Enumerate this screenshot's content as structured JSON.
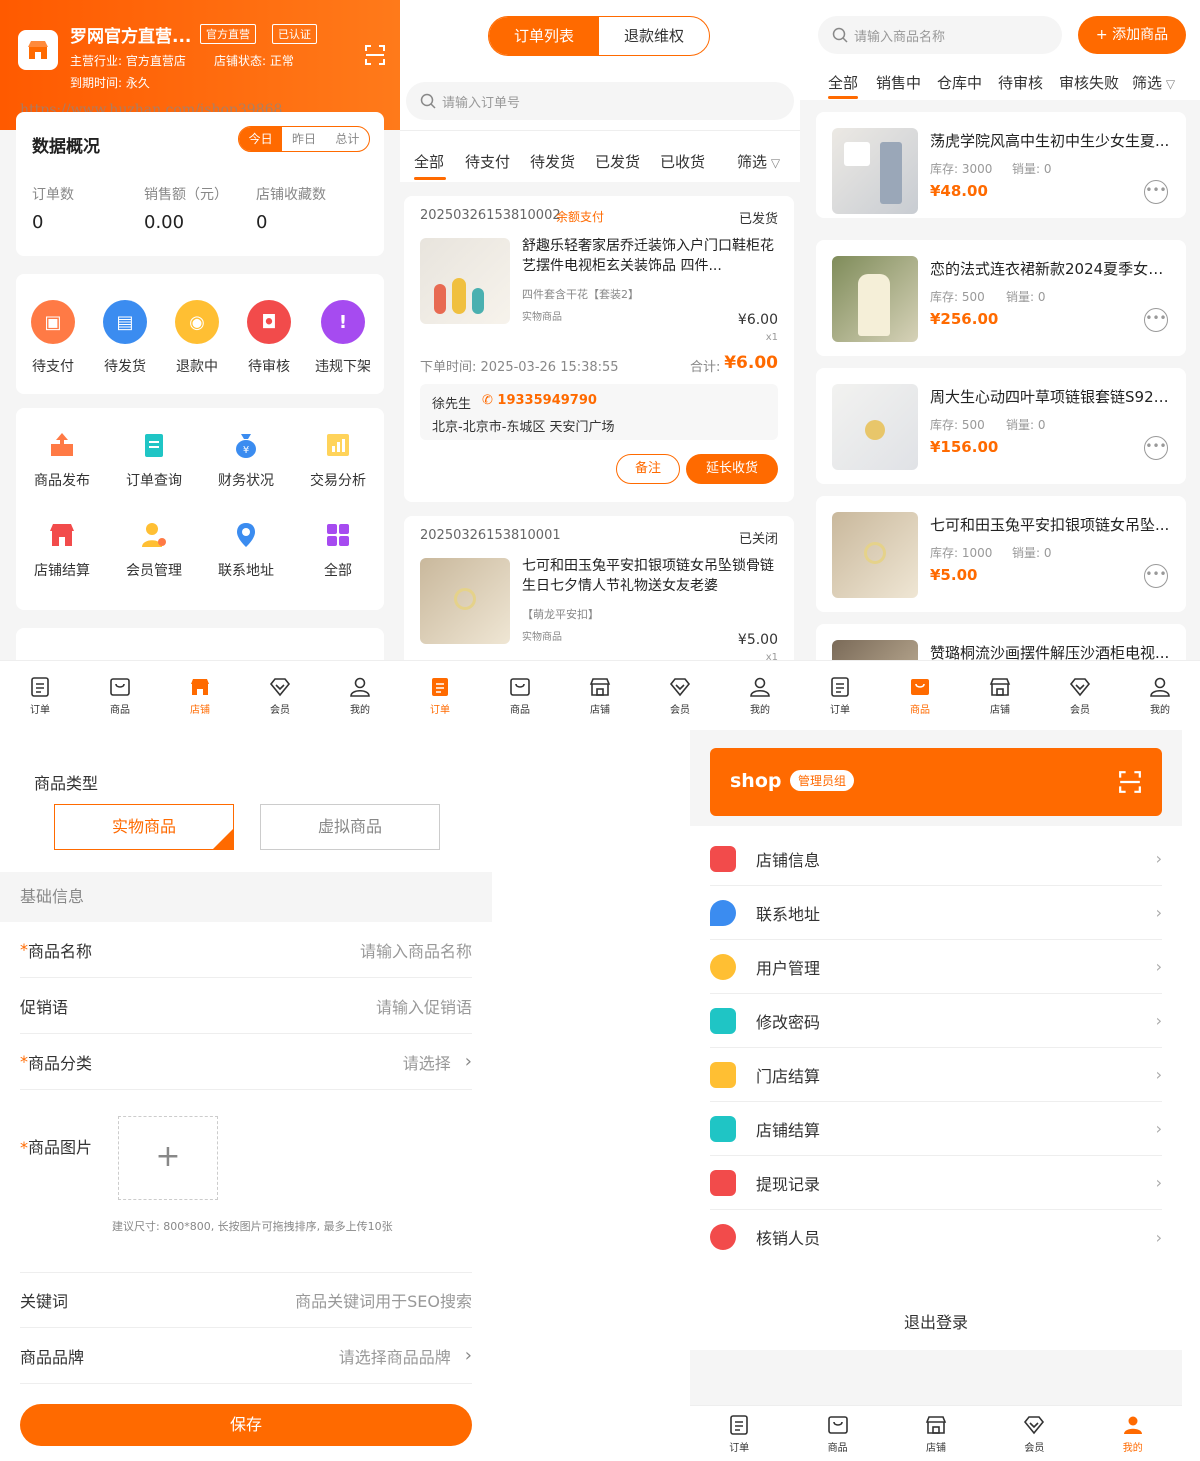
{
  "p1": {
    "shop_name": "罗网官方直营...",
    "badge1": "官方直营",
    "badge2": "已认证",
    "industry": "主营行业: 官方直营店",
    "status": "店铺状态: 正常",
    "expire": "到期时间: 永久",
    "watermark": "https://www.huzhan.com/ishop39868",
    "overview_title": "数据概况",
    "range_tabs": [
      "今日",
      "昨日",
      "总计"
    ],
    "stats": [
      {
        "label": "订单数",
        "value": "0"
      },
      {
        "label": "销售额（元）",
        "value": "0.00"
      },
      {
        "label": "店铺收藏数",
        "value": "0"
      }
    ],
    "order_status": [
      "待支付",
      "待发货",
      "退款中",
      "待审核",
      "违规下架"
    ],
    "tools": [
      "商品发布",
      "订单查询",
      "财务状况",
      "交易分析",
      "店铺结算",
      "会员管理",
      "联系地址",
      "全部"
    ]
  },
  "p2": {
    "seg": [
      "订单列表",
      "退款维权"
    ],
    "search_placeholder": "请输入订单号",
    "tabs": [
      "全部",
      "待支付",
      "待发货",
      "已发货",
      "已收货",
      "筛选"
    ],
    "order1": {
      "no": "20250326153810002",
      "pay": "余额支付",
      "status": "已发货",
      "title": "舒趣乐轻奢家居乔迁装饰入户门口鞋柜花艺摆件电视柜玄关装饰品 四件...",
      "spec": "四件套含干花【套装2】",
      "type": "实物商品",
      "price": "¥6.00",
      "qty": "x1",
      "time": "下单时间: 2025-03-26 15:38:55",
      "total_label": "合计:",
      "total": "¥6.00",
      "name": "徐先生",
      "phone": "19335949790",
      "addr": "北京-北京市-东城区 天安门广场",
      "btn_note": "备注",
      "btn_extend": "延长收货"
    },
    "order2": {
      "no": "20250326153810001",
      "status": "已关闭",
      "title": "七可和田玉兔平安扣银项链女吊坠锁骨链生日七夕情人节礼物送女友老婆",
      "spec": "【萌龙平安扣】",
      "type": "实物商品",
      "price": "¥5.00",
      "qty": "x1"
    }
  },
  "p3": {
    "search_placeholder": "请输入商品名称",
    "add_btn": "+ 添加商品",
    "tabs": [
      "全部",
      "销售中",
      "仓库中",
      "待审核",
      "审核失败",
      "筛选"
    ],
    "products": [
      {
        "title": "荡虎学院风高中生初中生少女生夏...",
        "stock": "库存: 3000",
        "sales": "销量: 0",
        "price": "¥48.00"
      },
      {
        "title": "恋的法式连衣裙新款2024夏季女生...",
        "stock": "库存: 500",
        "sales": "销量: 0",
        "price": "¥256.00"
      },
      {
        "title": "周大生心动四叶草项链银套链S925...",
        "stock": "库存: 500",
        "sales": "销量: 0",
        "price": "¥156.00"
      },
      {
        "title": "七可和田玉兔平安扣银项链女吊坠...",
        "stock": "库存: 1000",
        "sales": "销量: 0",
        "price": "¥5.00"
      },
      {
        "title": "赞璐桐流沙画摆件解压沙酒柜电视..."
      }
    ]
  },
  "p4": {
    "type_label": "商品类型",
    "type_opts": [
      "实物商品",
      "虚拟商品"
    ],
    "section": "基础信息",
    "name_label": "商品名称",
    "name_ph": "请输入商品名称",
    "promo_label": "促销语",
    "promo_ph": "请输入促销语",
    "cat_label": "商品分类",
    "cat_ph": "请选择",
    "img_label": "商品图片",
    "img_hint": "建议尺寸: 800*800, 长按图片可拖拽排序, 最多上传10张",
    "kw_label": "关键词",
    "kw_ph": "商品关键词用于SEO搜索",
    "brand_label": "商品品牌",
    "brand_ph": "请选择商品品牌",
    "save": "保存"
  },
  "p5": {
    "shop": "shop",
    "role": "管理员组",
    "menu": [
      "店铺信息",
      "联系地址",
      "用户管理",
      "修改密码",
      "门店结算",
      "店铺结算",
      "提现记录",
      "核销人员"
    ],
    "logout": "退出登录"
  },
  "nav": [
    "订单",
    "商品",
    "店铺",
    "会员",
    "我的"
  ],
  "colors": {
    "accent": "#ff6a00"
  }
}
